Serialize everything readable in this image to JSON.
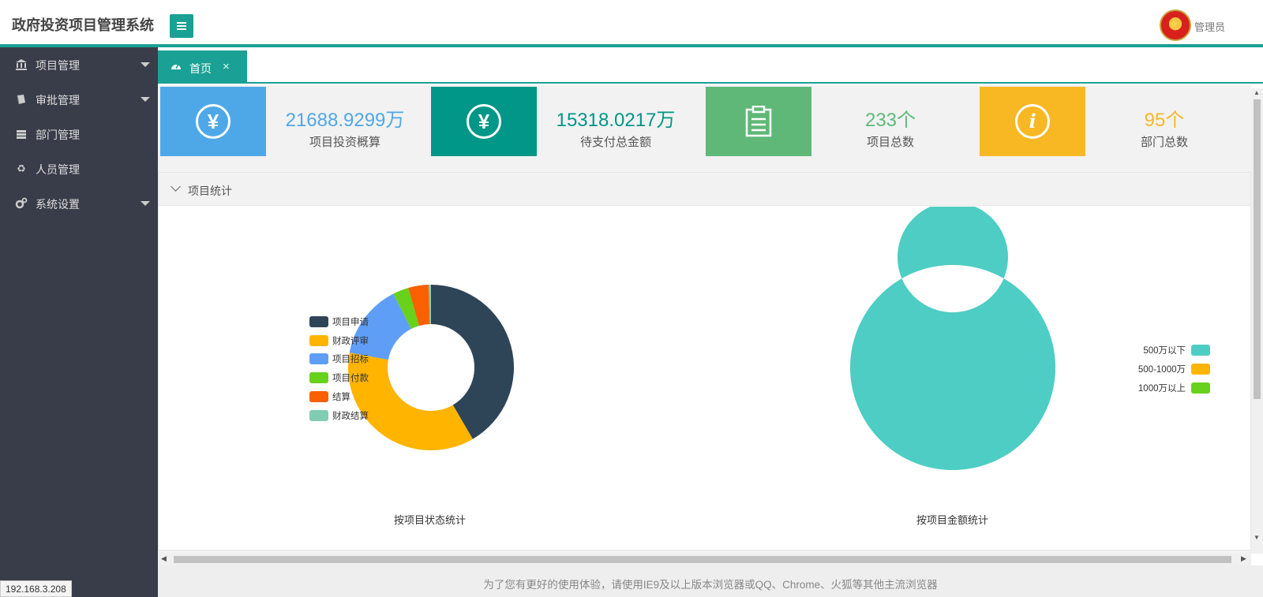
{
  "app": {
    "title": "政府投资项目管理系统",
    "user": "管理员"
  },
  "sidebar": {
    "items": [
      {
        "label": "项目管理",
        "icon": "bank-icon",
        "has_submenu": true
      },
      {
        "label": "审批管理",
        "icon": "book-icon",
        "has_submenu": true
      },
      {
        "label": "部门管理",
        "icon": "server-icon",
        "has_submenu": false
      },
      {
        "label": "人员管理",
        "icon": "recycle-icon",
        "has_submenu": false
      },
      {
        "label": "系统设置",
        "icon": "gears-icon",
        "has_submenu": true
      }
    ]
  },
  "tabs": [
    {
      "label": "首页",
      "icon": "dashboard-icon",
      "closable": true
    }
  ],
  "cards": [
    {
      "value": "21688.9299万",
      "label": "项目投资概算",
      "icon": "yen-icon",
      "color": "#4ea8e8",
      "glyph": "¥"
    },
    {
      "value": "15318.0217万",
      "label": "待支付总金额",
      "icon": "yen-icon",
      "color": "#009688",
      "glyph": "¥"
    },
    {
      "value": "233个",
      "label": "项目总数",
      "icon": "clipboard-icon",
      "color": "#5fb878",
      "glyph": ""
    },
    {
      "value": "95个",
      "label": "部门总数",
      "icon": "info-icon",
      "color": "#f7b824",
      "glyph": "i"
    }
  ],
  "panel": {
    "title": "项目统计"
  },
  "chart_data": [
    {
      "type": "pie",
      "caption": "按项目状态统计",
      "legend_position": "left",
      "categories": [
        "项目申请",
        "财政评审",
        "项目招标",
        "项目付款",
        "结算",
        "财政结算"
      ],
      "values": [
        94,
        82,
        33,
        7,
        9,
        1
      ],
      "colors": [
        "#2e4557",
        "#ffb400",
        "#5f9ef7",
        "#67d11b",
        "#f96000",
        "#81cdb4"
      ]
    },
    {
      "type": "pie",
      "caption": "按项目金额统计",
      "legend_position": "right",
      "categories": [
        "500万以下",
        "500-1000万",
        "1000万以上"
      ],
      "values": [
        233,
        0,
        0
      ],
      "colors": [
        "#4ecdc4",
        "#ffb400",
        "#67d11b"
      ]
    }
  ],
  "footer": {
    "text": "为了您有更好的使用体验，请使用IE9及以上版本浏览器或QQ、Chrome、火狐等其他主流浏览器"
  },
  "status": {
    "ip": "192.168.3.208"
  }
}
